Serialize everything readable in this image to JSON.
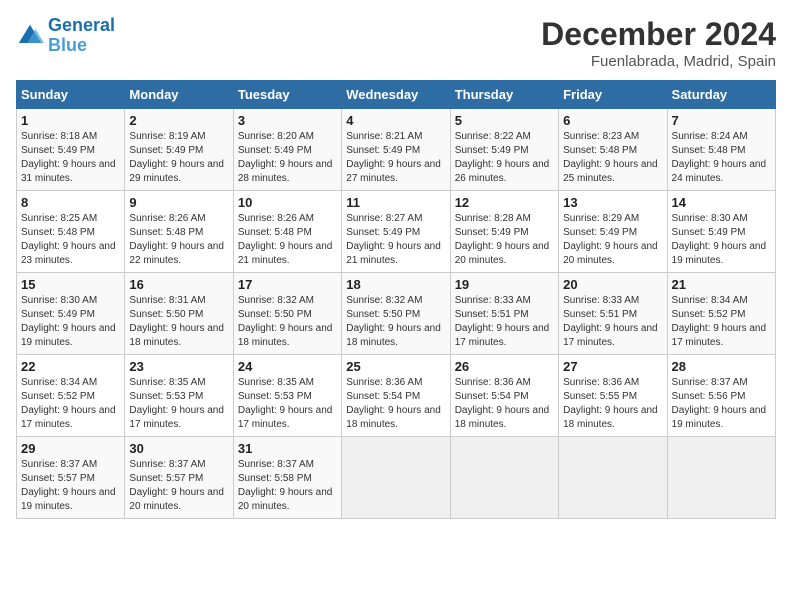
{
  "logo": {
    "line1": "General",
    "line2": "Blue"
  },
  "title": "December 2024",
  "subtitle": "Fuenlabrada, Madrid, Spain",
  "weekdays": [
    "Sunday",
    "Monday",
    "Tuesday",
    "Wednesday",
    "Thursday",
    "Friday",
    "Saturday"
  ],
  "weeks": [
    [
      {
        "day": "1",
        "info": "Sunrise: 8:18 AM\nSunset: 5:49 PM\nDaylight: 9 hours and 31 minutes."
      },
      {
        "day": "2",
        "info": "Sunrise: 8:19 AM\nSunset: 5:49 PM\nDaylight: 9 hours and 29 minutes."
      },
      {
        "day": "3",
        "info": "Sunrise: 8:20 AM\nSunset: 5:49 PM\nDaylight: 9 hours and 28 minutes."
      },
      {
        "day": "4",
        "info": "Sunrise: 8:21 AM\nSunset: 5:49 PM\nDaylight: 9 hours and 27 minutes."
      },
      {
        "day": "5",
        "info": "Sunrise: 8:22 AM\nSunset: 5:49 PM\nDaylight: 9 hours and 26 minutes."
      },
      {
        "day": "6",
        "info": "Sunrise: 8:23 AM\nSunset: 5:48 PM\nDaylight: 9 hours and 25 minutes."
      },
      {
        "day": "7",
        "info": "Sunrise: 8:24 AM\nSunset: 5:48 PM\nDaylight: 9 hours and 24 minutes."
      }
    ],
    [
      {
        "day": "8",
        "info": "Sunrise: 8:25 AM\nSunset: 5:48 PM\nDaylight: 9 hours and 23 minutes."
      },
      {
        "day": "9",
        "info": "Sunrise: 8:26 AM\nSunset: 5:48 PM\nDaylight: 9 hours and 22 minutes."
      },
      {
        "day": "10",
        "info": "Sunrise: 8:26 AM\nSunset: 5:48 PM\nDaylight: 9 hours and 21 minutes."
      },
      {
        "day": "11",
        "info": "Sunrise: 8:27 AM\nSunset: 5:49 PM\nDaylight: 9 hours and 21 minutes."
      },
      {
        "day": "12",
        "info": "Sunrise: 8:28 AM\nSunset: 5:49 PM\nDaylight: 9 hours and 20 minutes."
      },
      {
        "day": "13",
        "info": "Sunrise: 8:29 AM\nSunset: 5:49 PM\nDaylight: 9 hours and 20 minutes."
      },
      {
        "day": "14",
        "info": "Sunrise: 8:30 AM\nSunset: 5:49 PM\nDaylight: 9 hours and 19 minutes."
      }
    ],
    [
      {
        "day": "15",
        "info": "Sunrise: 8:30 AM\nSunset: 5:49 PM\nDaylight: 9 hours and 19 minutes."
      },
      {
        "day": "16",
        "info": "Sunrise: 8:31 AM\nSunset: 5:50 PM\nDaylight: 9 hours and 18 minutes."
      },
      {
        "day": "17",
        "info": "Sunrise: 8:32 AM\nSunset: 5:50 PM\nDaylight: 9 hours and 18 minutes."
      },
      {
        "day": "18",
        "info": "Sunrise: 8:32 AM\nSunset: 5:50 PM\nDaylight: 9 hours and 18 minutes."
      },
      {
        "day": "19",
        "info": "Sunrise: 8:33 AM\nSunset: 5:51 PM\nDaylight: 9 hours and 17 minutes."
      },
      {
        "day": "20",
        "info": "Sunrise: 8:33 AM\nSunset: 5:51 PM\nDaylight: 9 hours and 17 minutes."
      },
      {
        "day": "21",
        "info": "Sunrise: 8:34 AM\nSunset: 5:52 PM\nDaylight: 9 hours and 17 minutes."
      }
    ],
    [
      {
        "day": "22",
        "info": "Sunrise: 8:34 AM\nSunset: 5:52 PM\nDaylight: 9 hours and 17 minutes."
      },
      {
        "day": "23",
        "info": "Sunrise: 8:35 AM\nSunset: 5:53 PM\nDaylight: 9 hours and 17 minutes."
      },
      {
        "day": "24",
        "info": "Sunrise: 8:35 AM\nSunset: 5:53 PM\nDaylight: 9 hours and 17 minutes."
      },
      {
        "day": "25",
        "info": "Sunrise: 8:36 AM\nSunset: 5:54 PM\nDaylight: 9 hours and 18 minutes."
      },
      {
        "day": "26",
        "info": "Sunrise: 8:36 AM\nSunset: 5:54 PM\nDaylight: 9 hours and 18 minutes."
      },
      {
        "day": "27",
        "info": "Sunrise: 8:36 AM\nSunset: 5:55 PM\nDaylight: 9 hours and 18 minutes."
      },
      {
        "day": "28",
        "info": "Sunrise: 8:37 AM\nSunset: 5:56 PM\nDaylight: 9 hours and 19 minutes."
      }
    ],
    [
      {
        "day": "29",
        "info": "Sunrise: 8:37 AM\nSunset: 5:57 PM\nDaylight: 9 hours and 19 minutes."
      },
      {
        "day": "30",
        "info": "Sunrise: 8:37 AM\nSunset: 5:57 PM\nDaylight: 9 hours and 20 minutes."
      },
      {
        "day": "31",
        "info": "Sunrise: 8:37 AM\nSunset: 5:58 PM\nDaylight: 9 hours and 20 minutes."
      },
      null,
      null,
      null,
      null
    ]
  ]
}
